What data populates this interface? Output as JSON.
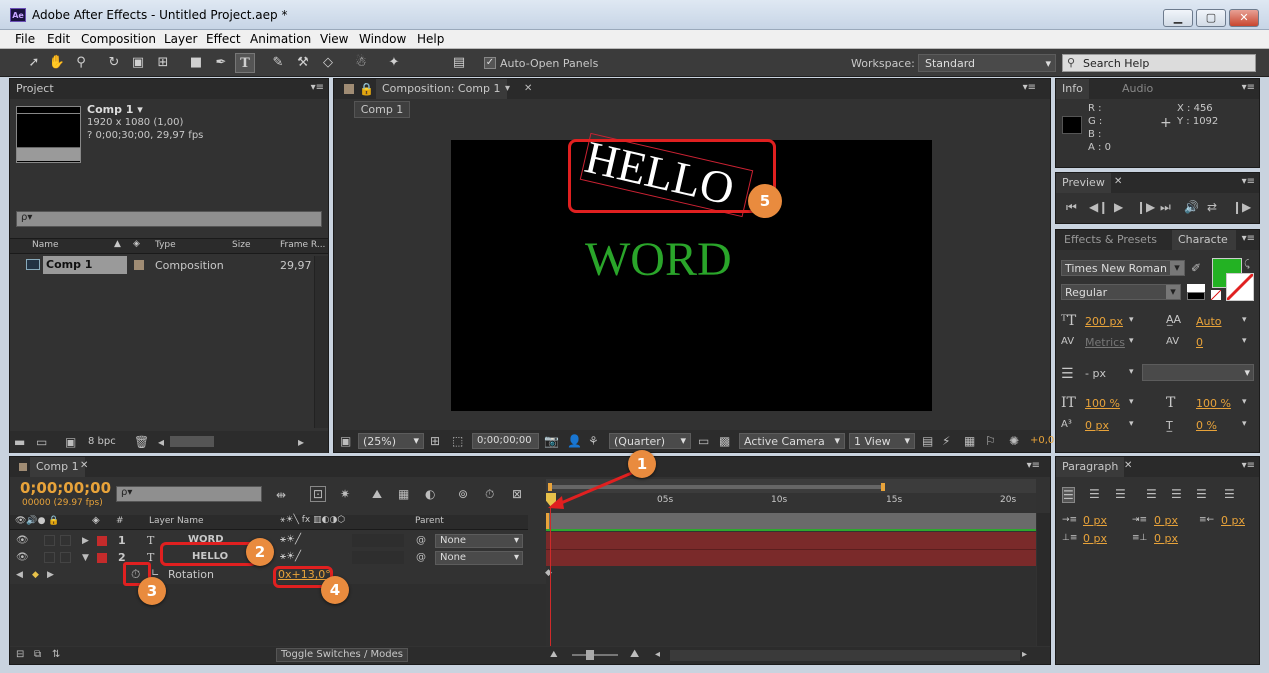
{
  "window": {
    "app_icon": "Ae",
    "title": "Adobe After Effects - Untitled Project.aep *",
    "min": "▁",
    "max": "▢",
    "close": "✕"
  },
  "menu": [
    "File",
    "Edit",
    "Composition",
    "Layer",
    "Effect",
    "Animation",
    "View",
    "Window",
    "Help"
  ],
  "toolbar": {
    "auto_open": "Auto-Open Panels",
    "workspace_label": "Workspace:",
    "workspace_value": "Standard",
    "search_placeholder": "Search Help"
  },
  "project": {
    "tab": "Project",
    "comp_name": "Comp 1 ▾",
    "comp_res": "1920 x 1080 (1,00)",
    "comp_dur": "? 0;00;30;00, 29,97 fps",
    "search_placeholder": "ρ▾",
    "col_name": "Name",
    "col_type": "Type",
    "col_size": "Size",
    "col_framerate": "Frame R...",
    "row_name": "Comp 1",
    "row_type": "Composition",
    "row_rate": "29,97",
    "bpc": "8 bpc"
  },
  "composition": {
    "tab": "Composition: Comp 1",
    "subtab": "Comp 1",
    "text_hello": "HELLO",
    "text_word": "WORD",
    "word_color": "#2aa52a",
    "zoom": "(25%)",
    "timecode": "0;00;00;00",
    "resolution": "(Quarter)",
    "camera": "Active Camera",
    "view": "1 View",
    "offset": "+0,0"
  },
  "info": {
    "tab": "Info",
    "tab2": "Audio",
    "r": "R :",
    "g": "G :",
    "b": "B :",
    "a": "A : 0",
    "x": "X : 456",
    "y": "Y : 1092"
  },
  "preview": {
    "tab": "Preview"
  },
  "character": {
    "tab1": "Effects & Presets",
    "tab2": "Characte",
    "font": "Times New Roman",
    "style": "Regular",
    "size": "200 px",
    "leading": "Auto",
    "kerning": "Metrics",
    "tracking": "0",
    "stroke": "- px",
    "vscale": "100 %",
    "hscale": "100 %",
    "baseline": "0 px",
    "tsume": "0 %",
    "fill_color": "#23b223"
  },
  "paragraph": {
    "tab": "Paragraph",
    "indent_left": "0 px",
    "indent_first": "0 px",
    "indent_right": "0 px",
    "space_before": "0 px",
    "space_after": "0 px"
  },
  "timeline": {
    "tab": "Comp 1",
    "timecode": "0;00;00;00",
    "frames": "00000 (29.97 fps)",
    "search_placeholder": "ρ▾",
    "col_layer": "Layer Name",
    "col_parent": "Parent",
    "col_num": "#",
    "layers": [
      {
        "num": "1",
        "name": "WORD",
        "parent": "None"
      },
      {
        "num": "2",
        "name": "HELLO",
        "parent": "None"
      }
    ],
    "property": "Rotation",
    "rotation_value": "0x+13,0°",
    "ruler": [
      "0s",
      "05s",
      "10s",
      "15s",
      "20s"
    ],
    "toggle": "Toggle Switches / Modes"
  },
  "callouts": [
    "1",
    "2",
    "3",
    "4",
    "5"
  ],
  "colors": {
    "accent": "#e8a33a",
    "callout": "#e98b3e",
    "highlight": "#e02020",
    "layer_bar": "#7a2a2a",
    "label_red": "#c42b2b"
  }
}
